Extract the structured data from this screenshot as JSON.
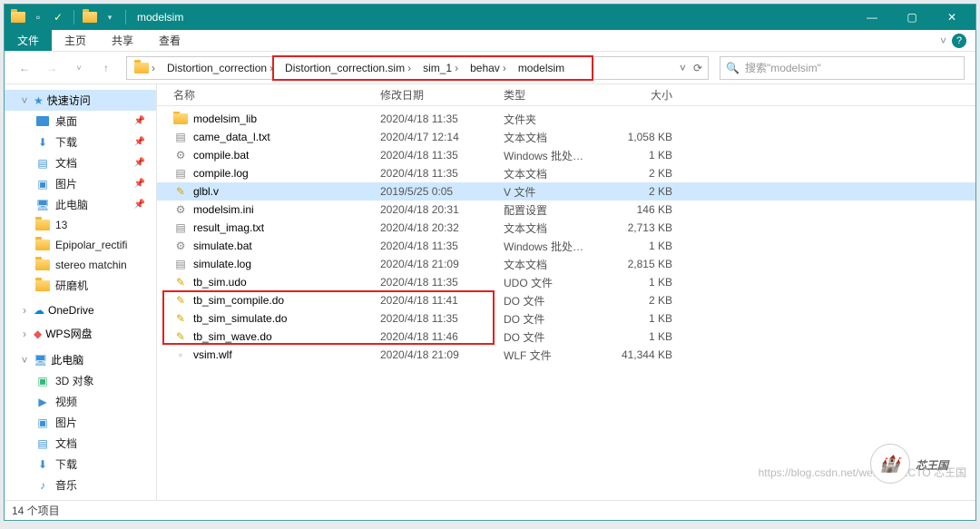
{
  "window": {
    "title": "modelsim"
  },
  "ribbon": {
    "file": "文件",
    "tabs": [
      "主页",
      "共享",
      "查看"
    ]
  },
  "breadcrumb": {
    "segments": [
      "Distortion_correction",
      "Distortion_correction.sim",
      "sim_1",
      "behav",
      "modelsim"
    ]
  },
  "search": {
    "placeholder": "搜索\"modelsim\""
  },
  "columns": {
    "name": "名称",
    "date": "修改日期",
    "type": "类型",
    "size": "大小"
  },
  "sidebar": {
    "quick": {
      "label": "快速访问",
      "items": [
        {
          "label": "桌面",
          "icon": "desktop",
          "pinned": true
        },
        {
          "label": "下载",
          "icon": "download",
          "pinned": true
        },
        {
          "label": "文档",
          "icon": "doc",
          "pinned": true
        },
        {
          "label": "图片",
          "icon": "pic",
          "pinned": true
        },
        {
          "label": "此电脑",
          "icon": "pc",
          "pinned": true
        },
        {
          "label": "13",
          "icon": "folder",
          "pinned": false
        },
        {
          "label": "Epipolar_rectifi",
          "icon": "folder",
          "pinned": false
        },
        {
          "label": "stereo matchin",
          "icon": "folder",
          "pinned": false
        },
        {
          "label": "研磨机",
          "icon": "folder",
          "pinned": false
        }
      ]
    },
    "onedrive": {
      "label": "OneDrive"
    },
    "wps": {
      "label": "WPS网盘"
    },
    "thispc": {
      "label": "此电脑",
      "items": [
        {
          "label": "3D 对象",
          "icon": "3d"
        },
        {
          "label": "视频",
          "icon": "video"
        },
        {
          "label": "图片",
          "icon": "pic"
        },
        {
          "label": "文档",
          "icon": "doc"
        },
        {
          "label": "下载",
          "icon": "download"
        },
        {
          "label": "音乐",
          "icon": "music"
        }
      ]
    }
  },
  "files": [
    {
      "name": "modelsim_lib",
      "date": "2020/4/18 11:35",
      "type": "文件夹",
      "size": "",
      "icon": "folder"
    },
    {
      "name": "came_data_l.txt",
      "date": "2020/4/17 12:14",
      "type": "文本文档",
      "size": "1,058 KB",
      "icon": "txt"
    },
    {
      "name": "compile.bat",
      "date": "2020/4/18 11:35",
      "type": "Windows 批处理...",
      "size": "1 KB",
      "icon": "bat"
    },
    {
      "name": "compile.log",
      "date": "2020/4/18 11:35",
      "type": "文本文档",
      "size": "2 KB",
      "icon": "txt"
    },
    {
      "name": "glbl.v",
      "date": "2019/5/25 0:05",
      "type": "V 文件",
      "size": "2 KB",
      "icon": "vfile",
      "selected": true
    },
    {
      "name": "modelsim.ini",
      "date": "2020/4/18 20:31",
      "type": "配置设置",
      "size": "146 KB",
      "icon": "ini"
    },
    {
      "name": "result_imag.txt",
      "date": "2020/4/18 20:32",
      "type": "文本文档",
      "size": "2,713 KB",
      "icon": "txt"
    },
    {
      "name": "simulate.bat",
      "date": "2020/4/18 11:35",
      "type": "Windows 批处理...",
      "size": "1 KB",
      "icon": "bat"
    },
    {
      "name": "simulate.log",
      "date": "2020/4/18 21:09",
      "type": "文本文档",
      "size": "2,815 KB",
      "icon": "txt"
    },
    {
      "name": "tb_sim.udo",
      "date": "2020/4/18 11:35",
      "type": "UDO 文件",
      "size": "1 KB",
      "icon": "do"
    },
    {
      "name": "tb_sim_compile.do",
      "date": "2020/4/18 11:41",
      "type": "DO 文件",
      "size": "2 KB",
      "icon": "do"
    },
    {
      "name": "tb_sim_simulate.do",
      "date": "2020/4/18 11:35",
      "type": "DO 文件",
      "size": "1 KB",
      "icon": "do"
    },
    {
      "name": "tb_sim_wave.do",
      "date": "2020/4/18 11:46",
      "type": "DO 文件",
      "size": "1 KB",
      "icon": "do"
    },
    {
      "name": "vsim.wlf",
      "date": "2020/4/18 21:09",
      "type": "WLF 文件",
      "size": "41,344 KB",
      "icon": "file"
    }
  ],
  "status": {
    "items_count": "14 个项目"
  },
  "brand": "芯王国",
  "watermark": "https://blog.csdn.net/we... @51CTO 芯王国"
}
